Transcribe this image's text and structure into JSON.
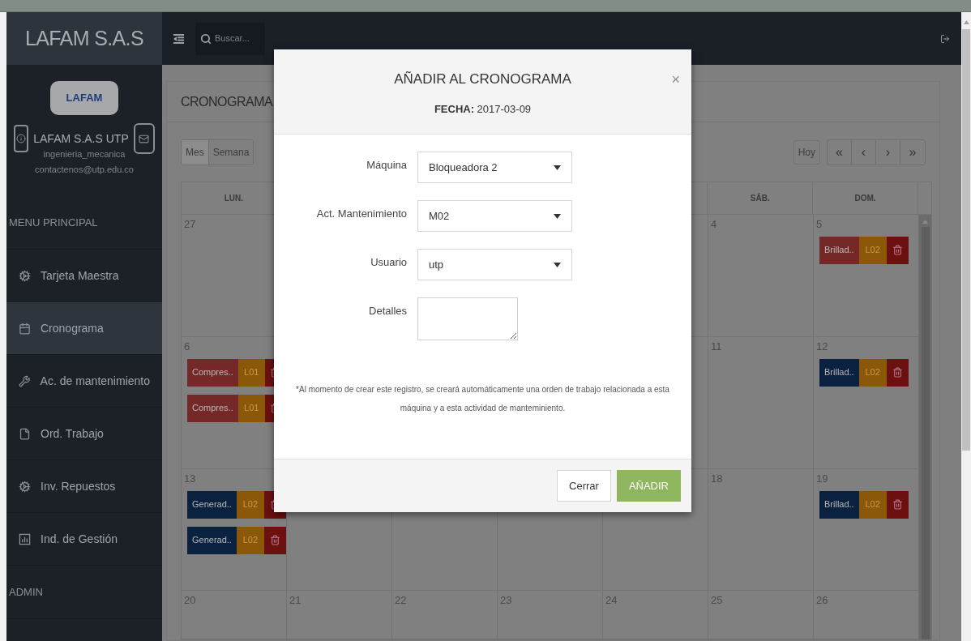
{
  "sidebar": {
    "brand": "LAFAM S.A.S",
    "logo": "LAFAM",
    "profile": {
      "name": "LAFAM S.A.S UTP",
      "role": "ingenieria_mecanica",
      "email": "contactenos@utp.edu.co"
    },
    "sections": [
      {
        "title": "MENU PRINCIPAL",
        "items": [
          {
            "label": "Tarjeta Maestra",
            "selected": false
          },
          {
            "label": "Cronograma",
            "selected": true
          },
          {
            "label": "Ac. de mantenimiento",
            "selected": false
          },
          {
            "label": "Ord. Trabajo",
            "selected": false
          },
          {
            "label": "Inv. Repuestos",
            "selected": false
          },
          {
            "label": "Ind. de Gestión",
            "selected": false
          }
        ]
      },
      {
        "title": "ADMIN"
      }
    ]
  },
  "topbar": {
    "search": {
      "placeholder": "Buscar..."
    }
  },
  "page": {
    "title": "CRONOGRAMA",
    "views": [
      {
        "label": "Mes",
        "selected": true
      },
      {
        "label": "Semana",
        "selected": false
      }
    ],
    "today": "Hoy",
    "nav": [
      "«",
      "‹",
      "›",
      "»"
    ]
  },
  "calendar": {
    "columns": {
      "mon": "LUN.",
      "sat": "SÁB.",
      "sun": "DOM."
    },
    "weeks": [
      {
        "mon": {
          "day": "27"
        },
        "sat": {
          "day": "4"
        },
        "sun": {
          "day": "5",
          "events": [
            {
              "label": "Brillad..",
              "code": "L02",
              "color": "#742828"
            }
          ]
        }
      },
      {
        "mon": {
          "day": "6",
          "events": [
            {
              "label": "Compres..",
              "code": "L01",
              "color": "#742828"
            },
            {
              "label": "Compres..",
              "code": "L01",
              "color": "#742828"
            }
          ]
        },
        "sat": {
          "day": "11"
        },
        "sun": {
          "day": "12",
          "events": [
            {
              "label": "Brillad..",
              "code": "L02",
              "color": "#0b2140"
            }
          ]
        }
      },
      {
        "mon": {
          "day": "13",
          "events": [
            {
              "label": "Generad..",
              "code": "L02",
              "color": "#0b2140"
            },
            {
              "label": "Generad..",
              "code": "L02",
              "color": "#0b2140"
            }
          ]
        },
        "sat": {
          "day": "18"
        },
        "sun": {
          "day": "19",
          "events": [
            {
              "label": "Brillad..",
              "code": "L02",
              "color": "#0b2140"
            }
          ]
        }
      },
      {
        "mon": {
          "day": "20"
        },
        "tue": {
          "day": "21"
        },
        "wed": {
          "day": "22"
        },
        "thu": {
          "day": "23"
        },
        "fri": {
          "day": "24"
        },
        "sat": {
          "day": "25"
        },
        "sun": {
          "day": "26"
        }
      }
    ]
  },
  "modal": {
    "title": "AÑADIR AL CRONOGRAMA",
    "subtitle": "**FECHA:** 2017-03-09",
    "close": "×",
    "fields": [
      {
        "kind": "select",
        "label": "Máquina",
        "value": "Bloqueadora 2"
      },
      {
        "kind": "select",
        "label": "Act. Mantenimiento",
        "value": "M02"
      },
      {
        "kind": "select",
        "label": "Usuario",
        "value": "utp"
      },
      {
        "kind": "textarea",
        "label": "Detalles"
      }
    ],
    "note": "*Al momento de crear este registro, se creará automáticamente una orden de trabajo relacionada a esta máquina y a esta actividad de manteminiento.",
    "buttons": [
      {
        "label": "Cerrar",
        "kind": "default"
      },
      {
        "label": "AÑADIR",
        "kind": "primary"
      }
    ]
  }
}
